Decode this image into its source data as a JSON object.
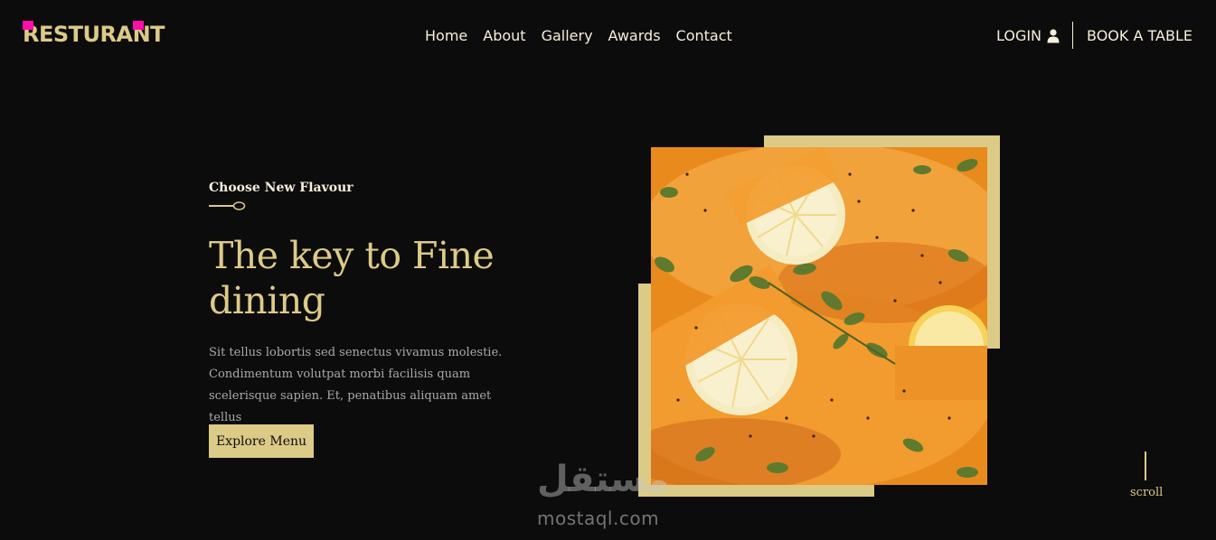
{
  "brand": {
    "name": "RESTURANT"
  },
  "nav": {
    "links": [
      "Home",
      "About",
      "Gallery",
      "Awards",
      "Contact"
    ],
    "login_label": "LOGIN",
    "book_label": "BOOK A TABLE"
  },
  "hero": {
    "subtitle": "Choose New Flavour",
    "headline": "The key to Fine dining",
    "description": "Sit tellus lobortis sed senectus vivamus molestie. Condimentum volutpat morbi facilisis quam scelerisque sapien. Et, penatibus aliquam amet tellus",
    "cta_label": "Explore Menu"
  },
  "scroll": {
    "label": "scroll"
  },
  "watermark": {
    "arabic": "مستقل",
    "latin": "mostaql.com"
  },
  "colors": {
    "background": "#0c0c0c",
    "accent": "#dcca87",
    "text": "#f5efdb",
    "muted": "#aaaaaa"
  },
  "icons": {
    "login": "user-icon",
    "divider": "spoon-icon"
  }
}
